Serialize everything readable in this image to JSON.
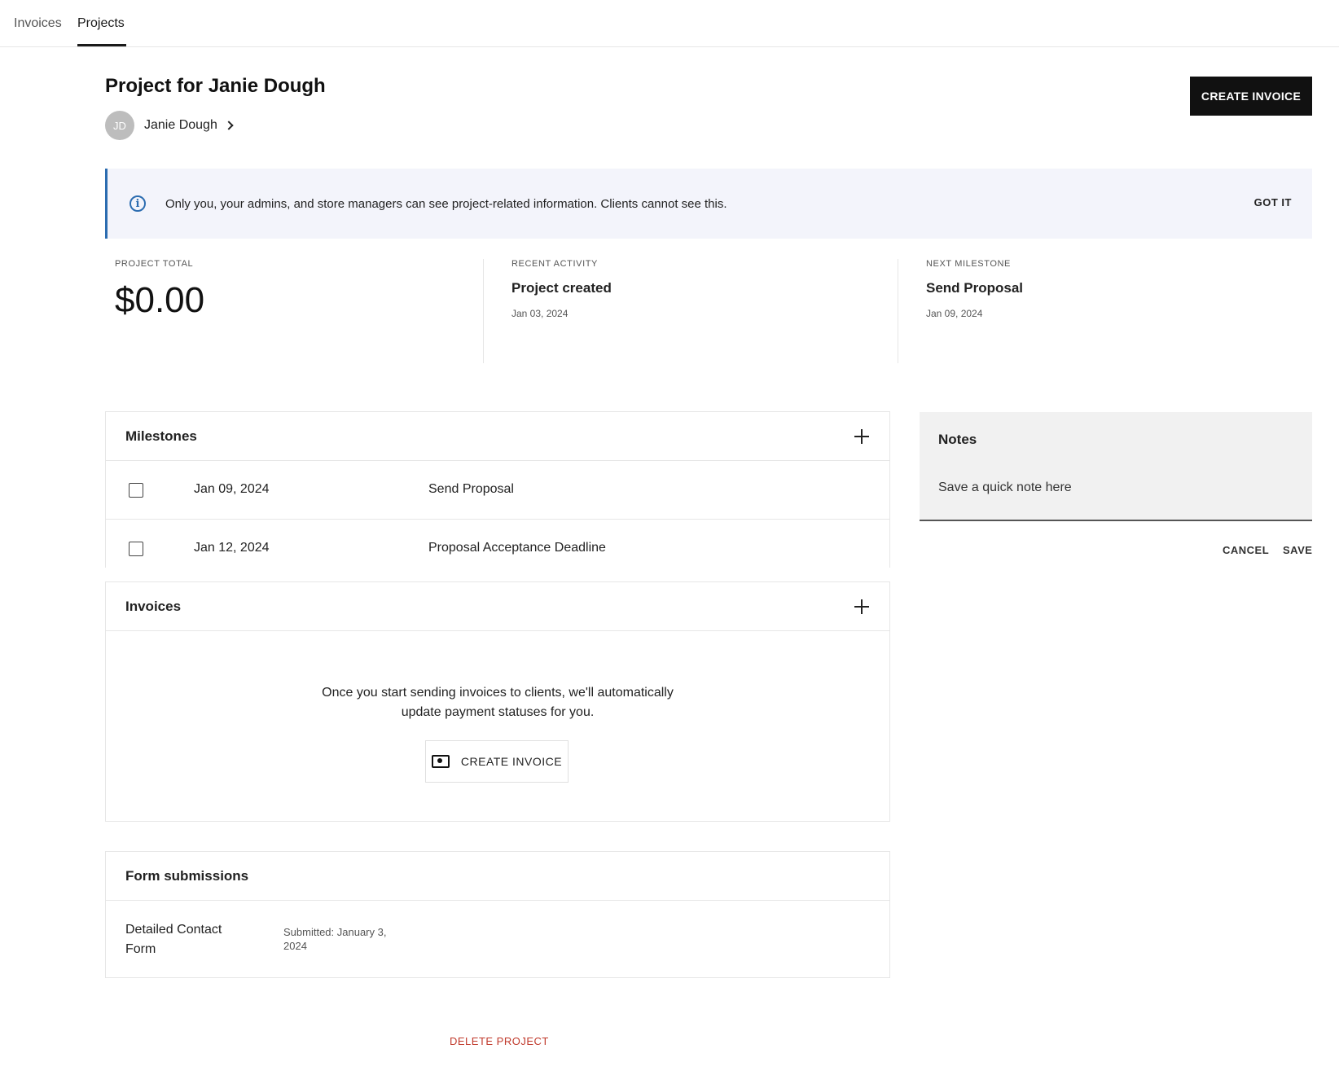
{
  "topnav": {
    "tabs": [
      {
        "label": "Invoices"
      },
      {
        "label": "Projects"
      }
    ],
    "active_tab": "Projects"
  },
  "header": {
    "title": "Project for Janie Dough",
    "client": {
      "initials": "JD",
      "name": "Janie Dough"
    },
    "create_invoice_label": "CREATE INVOICE"
  },
  "banner": {
    "text": "Only you, your admins, and store managers can see project-related information. Clients cannot see this.",
    "dismiss_label": "GOT IT",
    "icon": "info-icon"
  },
  "stats": {
    "total": {
      "label": "PROJECT TOTAL",
      "value": "$0.00"
    },
    "recent": {
      "label": "RECENT ACTIVITY",
      "title": "Project created",
      "date": "Jan 03, 2024"
    },
    "next": {
      "label": "NEXT MILESTONE",
      "title": "Send Proposal",
      "date": "Jan 09, 2024"
    }
  },
  "milestones": {
    "title": "Milestones",
    "items": [
      {
        "date": "Jan 09, 2024",
        "name": "Send Proposal",
        "done": false
      },
      {
        "date": "Jan 12, 2024",
        "name": "Proposal Acceptance Deadline",
        "done": false
      }
    ]
  },
  "invoices": {
    "title": "Invoices",
    "empty_line1": "Once you start sending invoices to clients, we'll automatically",
    "empty_line2": "update payment statuses for you.",
    "create_label": "CREATE INVOICE"
  },
  "forms": {
    "title": "Form submissions",
    "items": [
      {
        "name": "Detailed Contact Form",
        "submitted": "Submitted: January 3, 2024"
      }
    ]
  },
  "notes": {
    "title": "Notes",
    "placeholder": "Save a quick note here",
    "cancel_label": "CANCEL",
    "save_label": "SAVE"
  },
  "footer": {
    "delete_label": "DELETE PROJECT"
  },
  "colors": {
    "accent": "#2b6cb0",
    "danger": "#c0392b",
    "primary_button": "#111111",
    "banner_bg": "#f3f4fb"
  }
}
